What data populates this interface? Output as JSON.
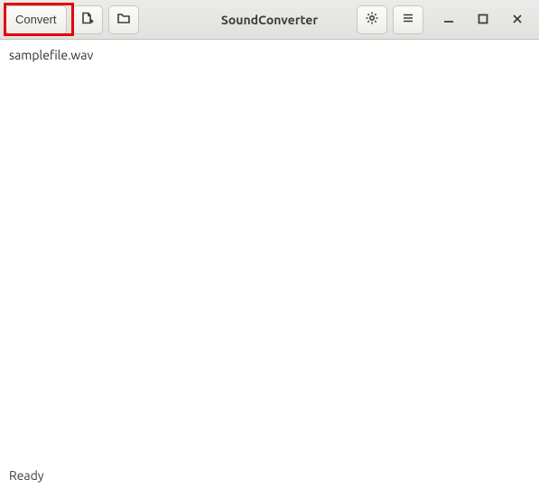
{
  "header": {
    "title": "SoundConverter",
    "convert_label": "Convert"
  },
  "files": [
    {
      "name": "samplefile.wav"
    }
  ],
  "status": {
    "text": "Ready"
  }
}
